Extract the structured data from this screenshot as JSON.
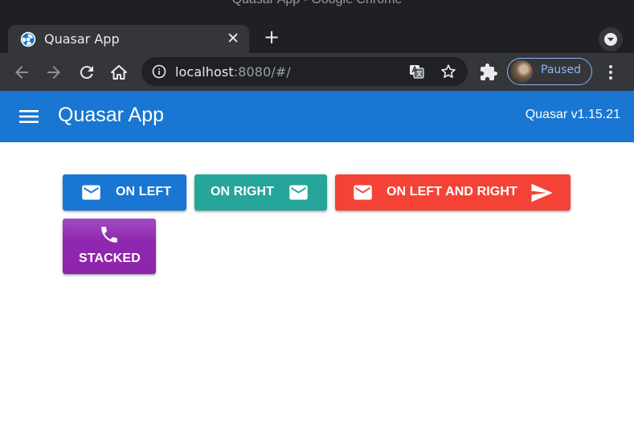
{
  "window": {
    "title": "Quasar App - Google Chrome"
  },
  "browser": {
    "tab": {
      "title": "Quasar App",
      "close_label": "✕"
    },
    "new_tab_label": "+",
    "url_host": "localhost",
    "url_rest": ":8080/#/",
    "profile_label": "Paused"
  },
  "header": {
    "title": "Quasar App",
    "version": "Quasar v1.15.21"
  },
  "buttons": {
    "on_left": "ON LEFT",
    "on_right": "ON RIGHT",
    "on_left_and_right": "ON LEFT AND RIGHT",
    "stacked": "STACKED"
  },
  "colors": {
    "primary": "#1976d2",
    "teal": "#26a69a",
    "red": "#f44336",
    "purple": "#8e24aa"
  },
  "icons": [
    "mail-icon",
    "send-icon",
    "phone-icon",
    "menu-icon"
  ]
}
